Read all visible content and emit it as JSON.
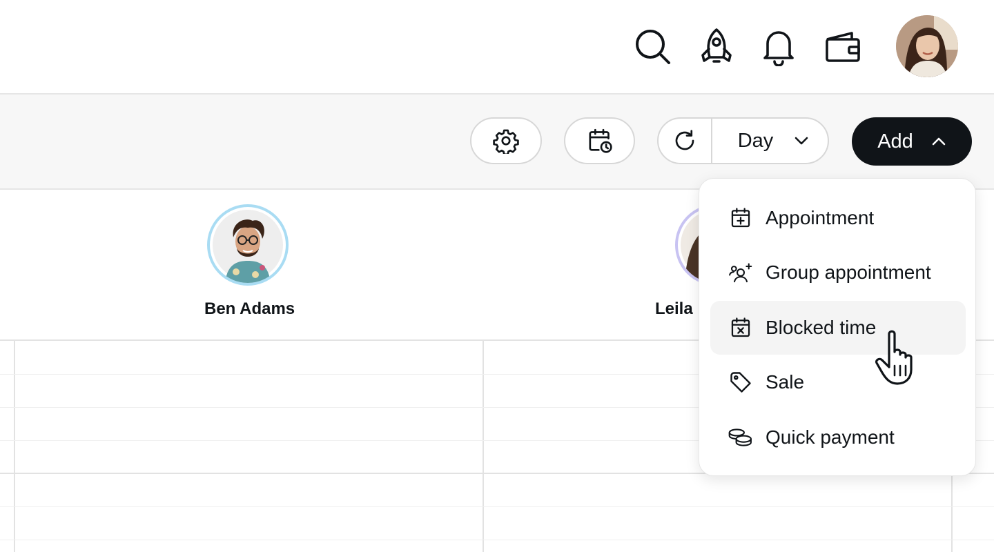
{
  "topbar": {
    "icons": [
      "search-icon",
      "rocket-icon",
      "bell-icon",
      "wallet-icon"
    ],
    "user_avatar": "user-avatar"
  },
  "toolbar": {
    "settings_icon": "gear-icon",
    "schedule_icon": "calendar-clock-icon",
    "refresh_icon": "refresh-icon",
    "view_label": "Day",
    "view_icon": "chevron-down-icon",
    "add_label": "Add",
    "add_icon": "chevron-up-icon"
  },
  "staff": [
    {
      "name": "Ben Adams",
      "ring_color": "#a9dcf3"
    },
    {
      "name": "Leila",
      "ring_color": "#c8c3f2"
    }
  ],
  "add_menu": {
    "items": [
      {
        "label": "Appointment",
        "icon": "calendar-plus-icon"
      },
      {
        "label": "Group appointment",
        "icon": "group-add-icon"
      },
      {
        "label": "Blocked time",
        "icon": "calendar-x-icon",
        "hovered": true
      },
      {
        "label": "Sale",
        "icon": "tag-icon"
      },
      {
        "label": "Quick payment",
        "icon": "coins-icon"
      }
    ]
  },
  "colors": {
    "primary_button": "#101418",
    "toolbar_bg": "#f7f7f7",
    "menu_hover": "#f4f4f4"
  }
}
